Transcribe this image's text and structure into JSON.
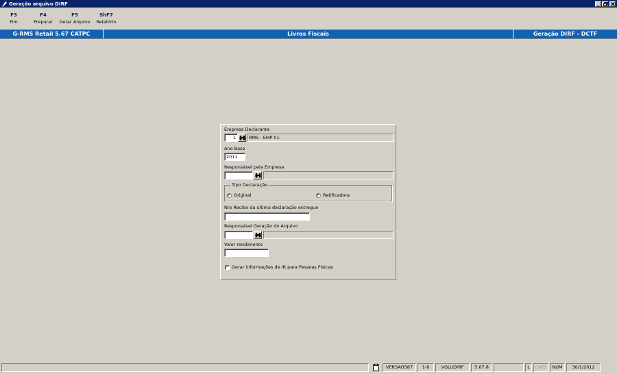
{
  "window": {
    "title": "Geração arquivo DIRF",
    "controls": [
      "minimize",
      "restore",
      "close"
    ]
  },
  "toolbar": {
    "buttons": [
      {
        "key": "F3",
        "label": "Fim"
      },
      {
        "key": "F4",
        "label": "Preparar"
      },
      {
        "key": "F5",
        "label": "Gerar Arquivo"
      },
      {
        "key": "ShF7",
        "label": "Relatório"
      }
    ]
  },
  "banner": {
    "system": "G-RMS Retail 5.67 CATPC",
    "module": "Livros Fiscais",
    "screen": "Geração DIRF - DCTF"
  },
  "form": {
    "empresa_declarante": {
      "label": "Empresa Declarante",
      "code": "1",
      "name": "RMS - EMP 01"
    },
    "ano_base": {
      "label": "Ano Base",
      "value": "2011"
    },
    "responsavel_empresa": {
      "label": "Responsável pela Empresa",
      "code": "",
      "name": ""
    },
    "tipo_declaracao": {
      "label": "Tipo Declaração",
      "options": [
        "Original",
        "Retificadora"
      ],
      "selected": null
    },
    "nro_recibo": {
      "label": "Nro Recibo da última declaração entregue",
      "value": ""
    },
    "responsavel_geracao": {
      "label": "Responsável Geração do Arquivo",
      "code": "",
      "name": ""
    },
    "valor_rendimento": {
      "label": "Valor rendimento",
      "value": ""
    },
    "gerar_ir_pf": {
      "label": "Gerar informações de IR para Pessoas Físicas",
      "checked": false
    }
  },
  "statusbar": {
    "version_tag": "VERSAO587",
    "page": "1-9",
    "user": "VGLUDIRF",
    "version": "5.67.8",
    "l": "L",
    "caps": "CAPS",
    "num": "NUM",
    "date": "30/1/2012"
  },
  "icons": {
    "lookup": "binoculars-icon",
    "clipboard": "clipboard-icon",
    "app": "pen-icon"
  }
}
